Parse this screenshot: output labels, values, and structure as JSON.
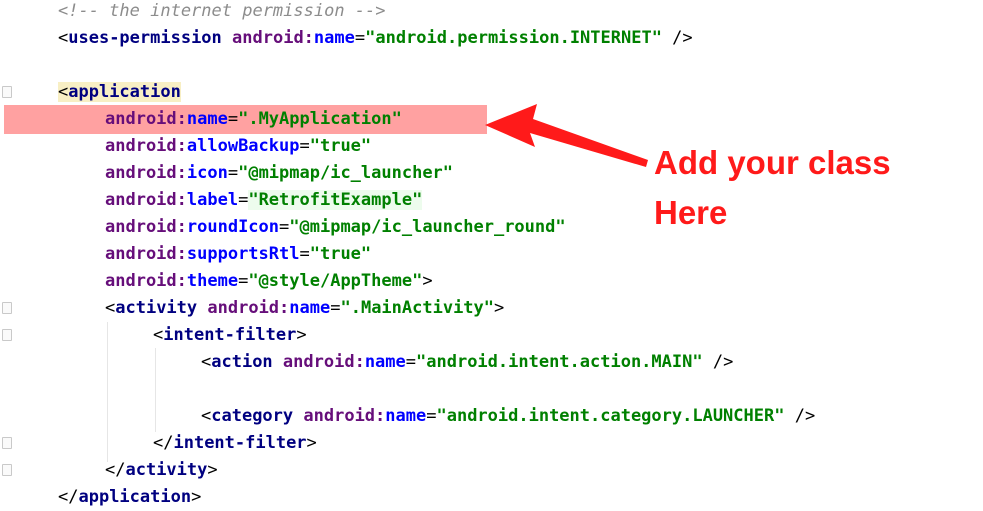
{
  "code": {
    "comment": "<!-- the internet permission -->",
    "uses_permission": {
      "open": "<",
      "tag": "uses-permission",
      "ns": "android:",
      "attr": "name",
      "eq": "=",
      "value": "\"android.permission.INTERNET\"",
      "close": " />"
    },
    "application_open": {
      "lt": "<",
      "tag": "application"
    },
    "app_attrs": [
      {
        "ns": "android:",
        "attr": "name",
        "value": "\".MyApplication\""
      },
      {
        "ns": "android:",
        "attr": "allowBackup",
        "value": "\"true\""
      },
      {
        "ns": "android:",
        "attr": "icon",
        "value": "\"@mipmap/ic_launcher\""
      },
      {
        "ns": "android:",
        "attr": "label",
        "value": "\"RetrofitExample\""
      },
      {
        "ns": "android:",
        "attr": "roundIcon",
        "value": "\"@mipmap/ic_launcher_round\""
      },
      {
        "ns": "android:",
        "attr": "supportsRtl",
        "value": "\"true\""
      },
      {
        "ns": "android:",
        "attr": "theme",
        "value": "\"@style/AppTheme\"",
        "suffix": ">"
      }
    ],
    "activity_open": {
      "lt": "<",
      "tag": "activity",
      "ns": "android:",
      "attr": "name",
      "value": "\".MainActivity\"",
      "gt": ">"
    },
    "intent_filter_open": {
      "lt": "<",
      "tag": "intent-filter",
      "gt": ">"
    },
    "action": {
      "lt": "<",
      "tag": "action",
      "ns": "android:",
      "attr": "name",
      "value": "\"android.intent.action.MAIN\"",
      "close": " />"
    },
    "category": {
      "lt": "<",
      "tag": "category",
      "ns": "android:",
      "attr": "name",
      "value": "\"android.intent.category.LAUNCHER\"",
      "close": " />"
    },
    "intent_filter_close": {
      "lt": "</",
      "tag": "intent-filter",
      "gt": ">"
    },
    "activity_close": {
      "lt": "</",
      "tag": "activity",
      "gt": ">"
    },
    "application_close": {
      "lt": "</",
      "tag": "application",
      "gt": ">"
    }
  },
  "annotation": {
    "line1": "Add your class",
    "line2": "Here",
    "color": "#ff1a1a"
  }
}
